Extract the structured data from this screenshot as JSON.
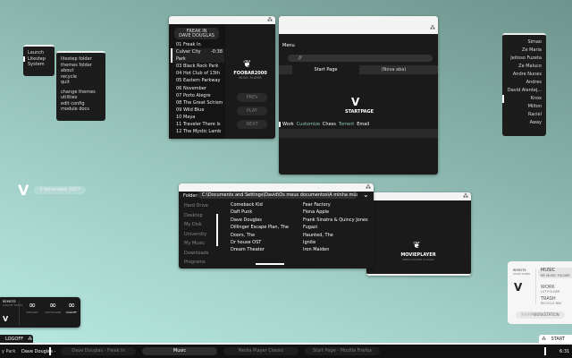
{
  "launch_menu": {
    "items": [
      "Launch",
      "Litestep",
      "System"
    ],
    "selected": 1
  },
  "litestep_menu": {
    "group1": [
      "litestep folder",
      "themes folder",
      "about",
      "recycle",
      "quit"
    ],
    "group2": [
      "change themes",
      "utilities",
      "edit config",
      "module docs"
    ]
  },
  "foobar": {
    "now_playing_title": "FREAK IN",
    "now_playing_artist": "DAVE DOUGLAS",
    "logo": "FOOBAR2000",
    "logo_sub": "MUSIC PLAYER",
    "tracks": [
      {
        "label": "01 Freak In"
      },
      {
        "label": "Culver City Park",
        "time": "-0:38"
      },
      {
        "label": "03 Black Rock Park"
      },
      {
        "label": "04 Hot Club of 13th"
      },
      {
        "label": "05 Eastern Parkway"
      },
      {
        "label": "06 November"
      },
      {
        "label": "07 Porto Alegre"
      },
      {
        "label": "08 The Great Schism"
      },
      {
        "label": "09 Wild Blue"
      },
      {
        "label": "10 Maya"
      },
      {
        "label": "11 Traveler There Is"
      },
      {
        "label": "12 The Mystic Lamb"
      }
    ],
    "prev": "PREV",
    "play": "PLAY",
    "next": "NEXT"
  },
  "firefox": {
    "menu": "Menu",
    "url": "//",
    "tabs": [
      "Start Page",
      "(Nova aba)"
    ],
    "logo": "STARTPAGE",
    "bookmarks": [
      {
        "label": "Work",
        "color": "#ffffff"
      },
      {
        "label": "Customize",
        "color": "#8fc7b6"
      },
      {
        "label": "Chess",
        "color": "#ffffff"
      },
      {
        "label": "Torrent",
        "color": "#8fc7b6"
      },
      {
        "label": "Email",
        "color": "#ffffff"
      }
    ]
  },
  "contacts": {
    "items": [
      "Simao",
      "Ze Maria",
      "Jeitoso Fuzeta",
      "Ze Maluco",
      "Andre Nunes",
      "Andres",
      "David Alentej...",
      "Knox",
      "Milton",
      "Raciel"
    ],
    "selected": 7,
    "status": "Away"
  },
  "desktop": {
    "date": "6 November 2007"
  },
  "file_browser": {
    "folder_label": "Folder:",
    "folder_path": "C:\\Documents and Settings\\David\\Os meus documentos\\A minha música\\Music",
    "places": [
      "Hard Drive",
      "Desktop",
      "My Disk",
      "University",
      "My Music",
      "Downloads",
      "Programs"
    ],
    "col1": [
      "Comeback Kid",
      "Daft Punk",
      "Dave Douglas",
      "Dillinger Escape Plan, The",
      "Doors, The",
      "Dr house OST",
      "Dream Theater"
    ],
    "col2": [
      "Fear Factory",
      "Fiona Apple",
      "Frank Sinatra & Quincy Jones",
      "Fugazi",
      "Haunted, The",
      "Ignite",
      "Iron Maiden"
    ]
  },
  "movie_player": {
    "logo": "MOVIEPLAYER",
    "sub": "MEDIA PLAYER CLASSIC"
  },
  "remote_left": {
    "title": "REMOTE",
    "sub": "LOGOFF PANEL",
    "buttons": [
      "RESTART",
      "SHUTDOWN",
      "LOGOFF"
    ],
    "tab": "LOGOFF"
  },
  "remote_right": {
    "title": "REMOTE",
    "sub": "START PANEL",
    "items": [
      {
        "label": "MUSIC",
        "sub": "MY MUSIC FOLDER"
      },
      {
        "label": "WORK",
        "sub": "LST FOLDER"
      },
      {
        "label": "TRASH",
        "sub": "RECYCLE BIN"
      }
    ],
    "workstation_a": "NAMIP",
    "workstation_b": "WORKSTATION",
    "tab": "START"
  },
  "taskbar": {
    "ticker_a": "y Park",
    "ticker_b": "Dave Douglas -",
    "tasks": [
      "Dave Douglas - Freak In",
      "Music",
      "Media Player Classic",
      "Start Page - Mozilla Firefox"
    ],
    "active": 1,
    "clock": "6:31"
  }
}
